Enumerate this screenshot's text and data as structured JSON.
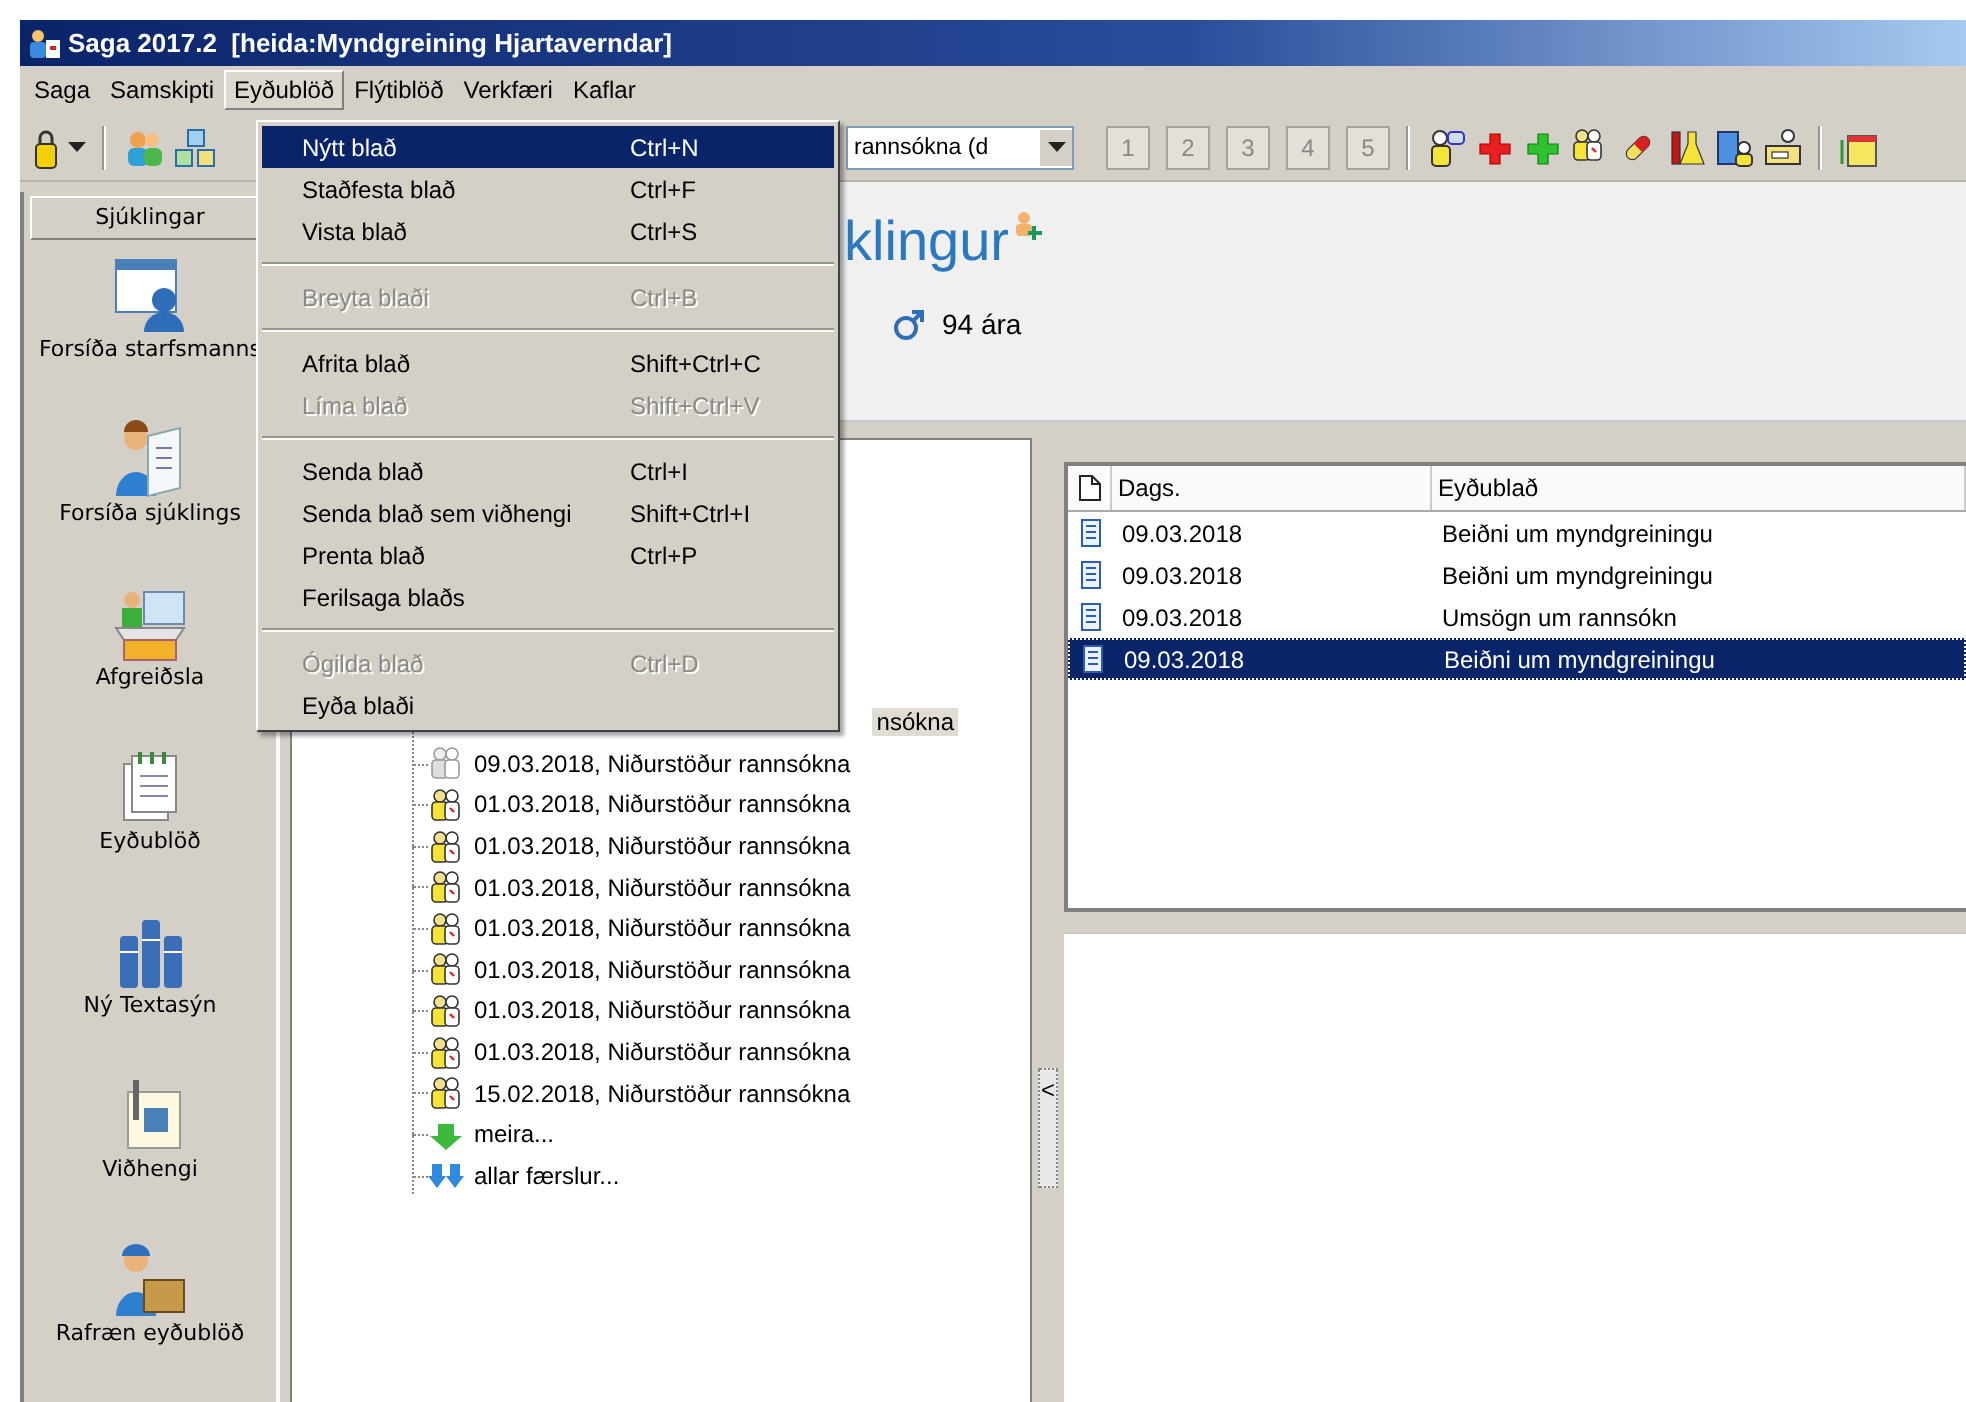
{
  "window": {
    "title": "Saga 2017.2  [heida:Myndgreining Hjartaverndar]"
  },
  "menu_bar": [
    {
      "label": "Saga",
      "selected": false
    },
    {
      "label": "Samskipti",
      "selected": false
    },
    {
      "label": "Eyðublöð",
      "selected": true
    },
    {
      "label": "Flýtiblöð",
      "selected": false
    },
    {
      "label": "Verkfæri",
      "selected": false
    },
    {
      "label": "Kaflar",
      "selected": false
    }
  ],
  "open_menu": [
    {
      "kind": "item",
      "label": "Nýtt blað",
      "shortcut": "Ctrl+N",
      "selected": true,
      "disabled": false
    },
    {
      "kind": "item",
      "label": "Staðfesta blað",
      "shortcut": "Ctrl+F",
      "selected": false,
      "disabled": false
    },
    {
      "kind": "item",
      "label": "Vista blað",
      "shortcut": "Ctrl+S",
      "selected": false,
      "disabled": false
    },
    {
      "kind": "separator"
    },
    {
      "kind": "item",
      "label": "Breyta blaði",
      "shortcut": "Ctrl+B",
      "selected": false,
      "disabled": true
    },
    {
      "kind": "separator"
    },
    {
      "kind": "item",
      "label": "Afrita blað",
      "shortcut": "Shift+Ctrl+C",
      "selected": false,
      "disabled": false
    },
    {
      "kind": "item",
      "label": "Líma blað",
      "shortcut": "Shift+Ctrl+V",
      "selected": false,
      "disabled": true
    },
    {
      "kind": "separator"
    },
    {
      "kind": "item",
      "label": "Senda blað",
      "shortcut": "Ctrl+I",
      "selected": false,
      "disabled": false
    },
    {
      "kind": "item",
      "label": "Senda blað sem viðhengi",
      "shortcut": "Shift+Ctrl+I",
      "selected": false,
      "disabled": false
    },
    {
      "kind": "item",
      "label": "Prenta blað",
      "shortcut": "Ctrl+P",
      "selected": false,
      "disabled": false
    },
    {
      "kind": "item",
      "label": "Ferilsaga blaðs",
      "selected": false,
      "disabled": false
    },
    {
      "kind": "separator"
    },
    {
      "kind": "item",
      "label": "Ógilda blað",
      "shortcut": "Ctrl+D",
      "selected": false,
      "disabled": true
    },
    {
      "kind": "item",
      "label": "Eyða blaði",
      "selected": false,
      "disabled": false
    }
  ],
  "toolbar": {
    "combo_value": "rannsókna (d",
    "numbered_buttons": [
      "1",
      "2",
      "3",
      "4",
      "5"
    ]
  },
  "sidebar": {
    "tab": "Sjúklingar",
    "items": [
      {
        "kind": "staff",
        "label": "Forsíða starfsmanns"
      },
      {
        "kind": "patient",
        "label": "Forsíða sjúklings"
      },
      {
        "kind": "desk",
        "label": "Afgreiðsla"
      },
      {
        "kind": "forms",
        "label": "Eyðublöð"
      },
      {
        "kind": "books",
        "label": "Ný Textasýn"
      },
      {
        "kind": "attachment",
        "label": "Viðhengi"
      },
      {
        "kind": "courier",
        "label": "Rafræn eyðublöð"
      }
    ]
  },
  "patient_header": {
    "name": "klingur",
    "age": "94 ára"
  },
  "tree": [
    {
      "kind": "cut",
      "text": "nsókna",
      "selected": true
    },
    {
      "kind": "record",
      "text": "09.03.2018, Niðurstöður rannsókna",
      "dimmed": true,
      "selected": false
    },
    {
      "kind": "record",
      "text": "01.03.2018, Niðurstöður rannsókna",
      "dimmed": false,
      "selected": false
    },
    {
      "kind": "record",
      "text": "01.03.2018, Niðurstöður rannsókna",
      "dimmed": false,
      "selected": false
    },
    {
      "kind": "record",
      "text": "01.03.2018, Niðurstöður rannsókna",
      "dimmed": false,
      "selected": false
    },
    {
      "kind": "record",
      "text": "01.03.2018, Niðurstöður rannsókna",
      "dimmed": false,
      "selected": false
    },
    {
      "kind": "record",
      "text": "01.03.2018, Niðurstöður rannsókna",
      "dimmed": false,
      "selected": false
    },
    {
      "kind": "record",
      "text": "01.03.2018, Niðurstöður rannsókna",
      "dimmed": false,
      "selected": false
    },
    {
      "kind": "record",
      "text": "01.03.2018, Niðurstöður rannsókna",
      "dimmed": false,
      "selected": false
    },
    {
      "kind": "record",
      "text": "15.02.2018, Niðurstöður rannsókna",
      "dimmed": false,
      "selected": false
    },
    {
      "kind": "more",
      "text": "meira...",
      "selected": false
    },
    {
      "kind": "all",
      "text": "allar færslur...",
      "selected": false
    }
  ],
  "splitter": {
    "label": "<"
  },
  "form_list": {
    "columns": [
      "Dags.",
      "Eyðublað"
    ],
    "rows": [
      {
        "date": "09.03.2018",
        "form": "Beiðni um myndgreiningu",
        "selected": false
      },
      {
        "date": "09.03.2018",
        "form": "Beiðni um myndgreiningu",
        "selected": false
      },
      {
        "date": "09.03.2018",
        "form": "Umsögn um rannsókn",
        "selected": false
      },
      {
        "date": "09.03.2018",
        "form": "Beiðni um myndgreiningu",
        "selected": true
      }
    ]
  }
}
